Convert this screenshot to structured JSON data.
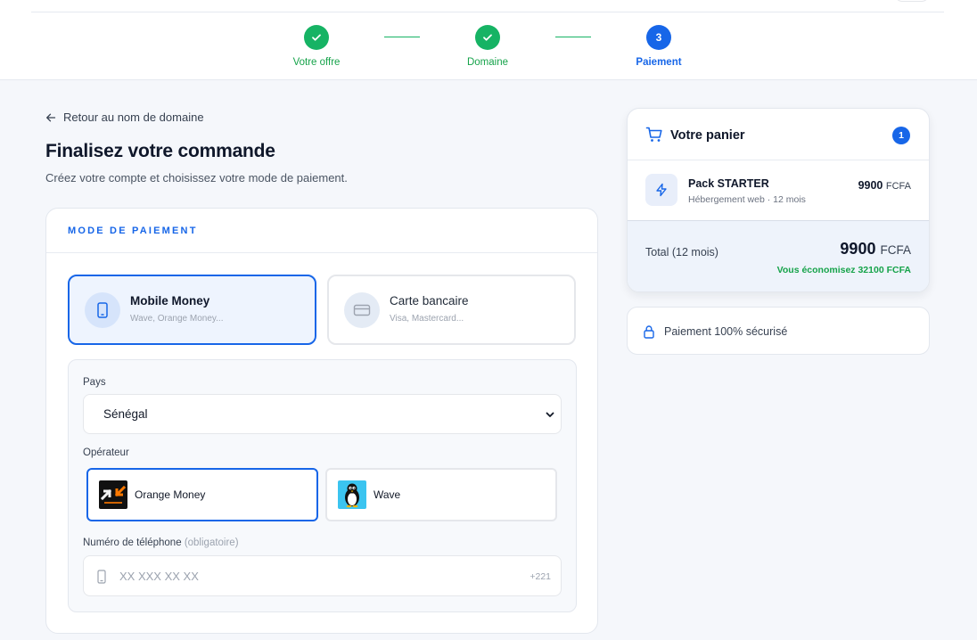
{
  "stepper": {
    "steps": [
      {
        "label": "Votre offre",
        "state": "done",
        "number": ""
      },
      {
        "label": "Domaine",
        "state": "done",
        "number": ""
      },
      {
        "label": "Paiement",
        "state": "active",
        "number": "3"
      }
    ]
  },
  "page": {
    "back_link": "Retour au nom de domaine",
    "title": "Finalisez votre commande",
    "subtitle": "Créez votre compte et choisissez votre mode de paiement."
  },
  "payment": {
    "section_title": "MODE DE PAIEMENT",
    "methods": [
      {
        "name": "Mobile Money",
        "description": "Wave, Orange Money...",
        "icon": "smartphone-icon",
        "selected": true
      },
      {
        "name": "Carte bancaire",
        "description": "Visa, Mastercard...",
        "icon": "credit-card-icon",
        "selected": false
      }
    ],
    "country_label": "Pays",
    "country_value": "Sénégal",
    "operator_label": "Opérateur",
    "operators": [
      {
        "name": "Orange Money",
        "icon": "orange-money-logo",
        "selected": true
      },
      {
        "name": "Wave",
        "icon": "wave-penguin-logo",
        "selected": false
      }
    ],
    "phone_label": "Numéro de téléphone",
    "phone_label_hint": "(obligatoire)",
    "phone_placeholder": "XX XXX XX XX",
    "phone_prefix": "+221"
  },
  "cart": {
    "title": "Votre panier",
    "count": "1",
    "item": {
      "name": "Pack STARTER",
      "description": "Hébergement web · 12 mois",
      "price": "9900",
      "currency": "FCFA"
    },
    "total_label": "Total (12 mois)",
    "total_price": "9900",
    "total_currency": "FCFA",
    "savings": "Vous économisez 32100 FCFA"
  },
  "security": {
    "text": "Paiement 100% sécurisé"
  },
  "colors": {
    "primary": "#1766e8",
    "success": "#16b364",
    "background": "#f5f7fb"
  }
}
